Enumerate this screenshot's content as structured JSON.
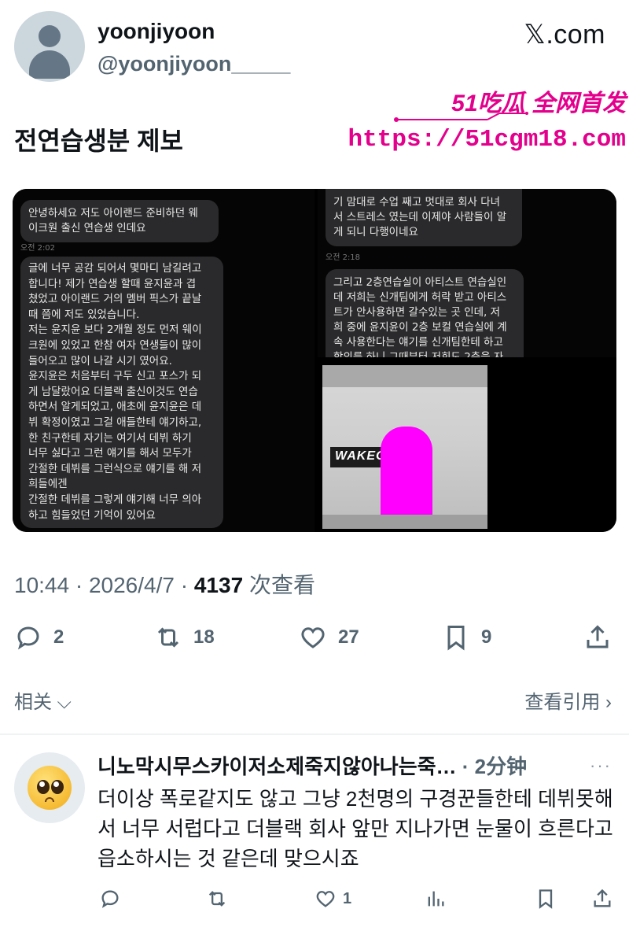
{
  "author": {
    "display_name": "yoonjiyoon",
    "handle": "@yoonjiyoon_____"
  },
  "site_label": "𝕏.com",
  "watermark": {
    "line1": "51吃瓜 全网首发",
    "line2": "https://51cgm18.com",
    "color": "#e3008c"
  },
  "tweet": {
    "text": "전연습생분 제보",
    "time": "10:44",
    "date": "2026/4/7",
    "views": "4137",
    "views_label": "次查看",
    "sep": " · "
  },
  "screens": {
    "left": {
      "bubble1": "안녕하세요 저도 아이랜드 준비하던 웨\n이크원 출신 연습생 인데요",
      "time1": "오전 2:02",
      "bubble2": "글에 너무 공감 되어서 몇마디 남길려고\n합니다! 제가 연습생 할때 윤지윤과 겹\n쳤었고 아이랜드 거의 멤버 픽스가 끝날\n때 쯤에 저도 있었습니다.\n저는 윤지윤 보다 2개월 정도 먼저 웨이\n크원에 있었고 한참 여자 연생들이 많이\n들어오고 많이 나갈 시기 였어요.\n윤지윤은 처음부터 구두 신고 포스가 되\n게 남달랐어요 더블랙 출신이것도 연습\n하면서 알게되었고, 애초에 윤지윤은 데\n뷔 확정이였고 그걸 애들한테 얘기하고,\n한 친구한테 자기는 여기서 데뷔 하기\n너무 싫다고 그런 얘기를 해서 모두가\n간절한 데뷔를 그런식으로 얘기를 해 저\n희들에겐\n간절한 데뷔를 그렇게 얘기해 너무 의아\n하고 힘들었던 기억이 있어요"
    },
    "right_top": {
      "bubble1": "기 맘대로 수업 째고 멋대로 회사 다녀\n서 스트레스 였는데 이제야 사람들이 알\n게 되니 다행이네요",
      "time1": "오전 2:18",
      "bubble2": "그리고 2층연습실이 아티스트 연습실인\n데 저희는 신개팀에게 허락 받고 아티스\n트가 안사용하면 갈수있는 곳 인데, 저\n희 중에 윤지윤이 2층 보컬 연습실에 계\n속 사용한다는 얘기를 신개팀한테 하고\n항의를 하니 그때부터 저희도 2층을 자"
    },
    "right_bottom": {
      "sign_text": "WAKEONE"
    }
  },
  "actions": {
    "replies": "2",
    "reposts": "18",
    "likes": "27",
    "bookmarks": "9"
  },
  "related": {
    "label": "相关",
    "quotes_label": "查看引用"
  },
  "reply": {
    "name": "니노막시무스카이저소제죽지않아나는죽…",
    "time": " · 2分钟",
    "more": "···",
    "text": "더이상 폭로같지도 않고 그냥 2천명의 구경꾼들한테 데뷔못해서 너무 서럽다고 더블랙 회사 앞만 지나가면 눈물이 흐른다고 읍소하시는 것 같은데 맞으시죠",
    "likes": "1"
  }
}
